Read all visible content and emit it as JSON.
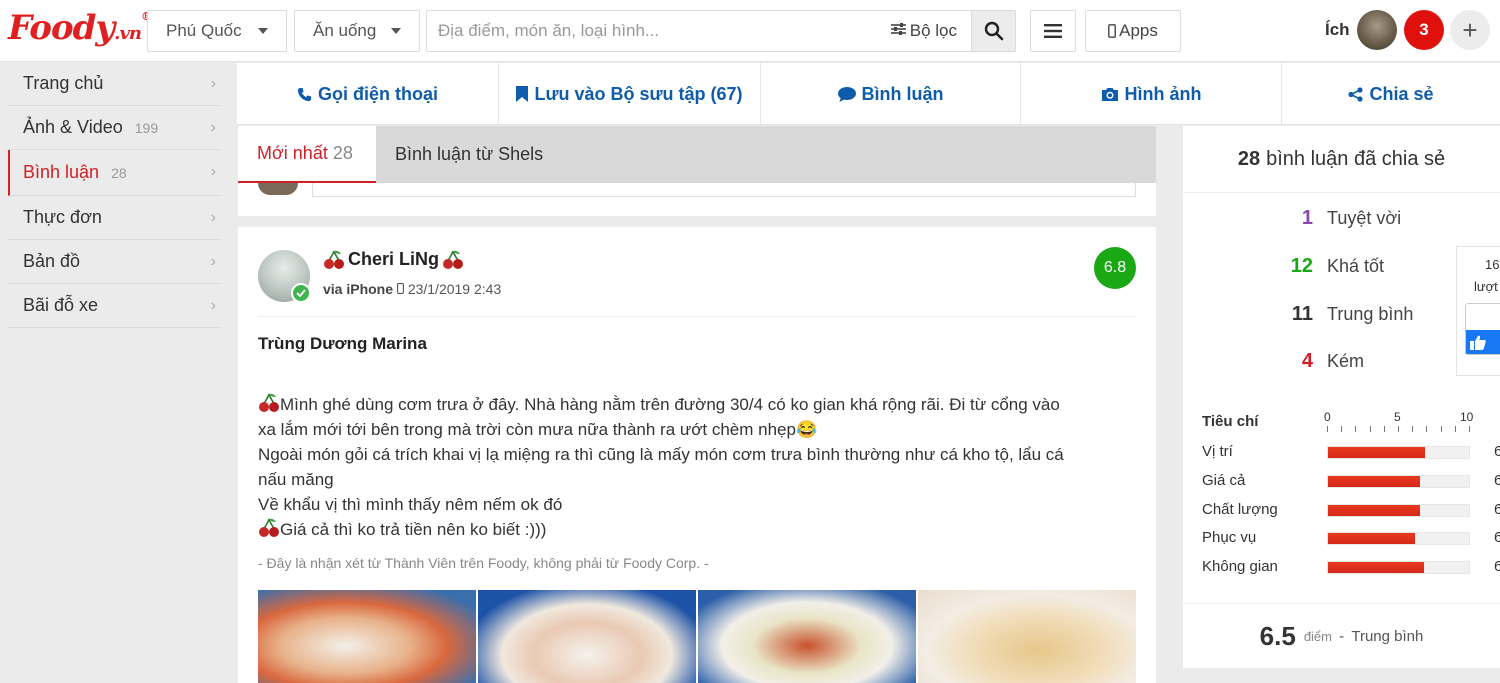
{
  "brand": {
    "logo_main": "Foody",
    "logo_tld": ".vn",
    "logo_reg": "®",
    "accent": "#cf2127",
    "link": "#0f5cad"
  },
  "header": {
    "location": "Phú Quốc",
    "category": "Ăn uống",
    "search_placeholder": "Địa điểm, món ăn, loại hình...",
    "filter_label": "Bộ lọc",
    "apps_label": "Apps",
    "username": "Ích",
    "notification_count": "3",
    "add_label": "+"
  },
  "sidebar": {
    "items": [
      {
        "label": "Trang chủ",
        "count": ""
      },
      {
        "label": "Ảnh & Video",
        "count": "199"
      },
      {
        "label": "Bình luận",
        "count": "28"
      },
      {
        "label": "Thực đơn",
        "count": ""
      },
      {
        "label": "Bản đồ",
        "count": ""
      },
      {
        "label": "Bãi đỗ xe",
        "count": ""
      }
    ],
    "active_index": 2
  },
  "actions": [
    {
      "label": "Gọi điện thoại",
      "icon": "phone-icon"
    },
    {
      "label": "Lưu vào Bộ sưu tập (67)",
      "icon": "bookmark-icon"
    },
    {
      "label": "Bình luận",
      "icon": "comment-icon"
    },
    {
      "label": "Hình ảnh",
      "icon": "camera-icon"
    },
    {
      "label": "Chia sẻ",
      "icon": "share-icon"
    }
  ],
  "tabs": {
    "latest_label": "Mới nhất",
    "latest_count": "28",
    "shels_label": "Bình luận từ Shels"
  },
  "review": {
    "author": "Cheri LiNg",
    "via": "via iPhone",
    "date": "23/1/2019 2:43",
    "score": "6.8",
    "title": "Trùng Dương Marina",
    "lines": [
      "Mình ghé dùng cơm trưa ở đây. Nhà hàng nằm trên đường 30/4 có ko gian khá rộng rãi. Đi từ cổng vào",
      "xa lắm mới tới bên trong mà trời còn mưa nữa thành ra ướt chèm nhẹp",
      "Ngoài món gỏi cá trích khai vị lạ miệng ra thì cũng là mấy món cơm trưa bình thường như cá kho tộ, lẩu cá",
      "nấu măng",
      "Về khẩu vị thì mình thấy nêm nếm ok đó",
      "Giá cả thì ko trả tiền nên ko biết :)))"
    ],
    "emoji_laugh": "😂",
    "note": "- Đây là nhận xét từ Thành Viên trên Foody, không phải từ Foody Corp. -"
  },
  "summary": {
    "total": "28",
    "total_label": "bình luận đã chia sẻ",
    "ratings": [
      {
        "count": "1",
        "label": "Tuyệt vời",
        "color": "#8e44ad"
      },
      {
        "count": "12",
        "label": "Khá tốt",
        "color": "#1aa914"
      },
      {
        "count": "11",
        "label": "Trung bình",
        "color": "#333333"
      },
      {
        "count": "4",
        "label": "Kém",
        "color": "#cf2127"
      }
    ],
    "fb_count": "16",
    "fb_luot": "lượt"
  },
  "criteria": {
    "header": "Tiêu chí",
    "scale": [
      "0",
      "5",
      "10"
    ],
    "items": [
      {
        "label": "Vị trí",
        "value": 6.9,
        "display": "6"
      },
      {
        "label": "Giá cả",
        "value": 6.5,
        "display": "6"
      },
      {
        "label": "Chất lượng",
        "value": 6.5,
        "display": "6"
      },
      {
        "label": "Phục vụ",
        "value": 6.2,
        "display": "6"
      },
      {
        "label": "Không gian",
        "value": 6.8,
        "display": "6"
      }
    ],
    "average": "6.5",
    "average_unit": "điểm",
    "average_label": "Trung bình"
  }
}
